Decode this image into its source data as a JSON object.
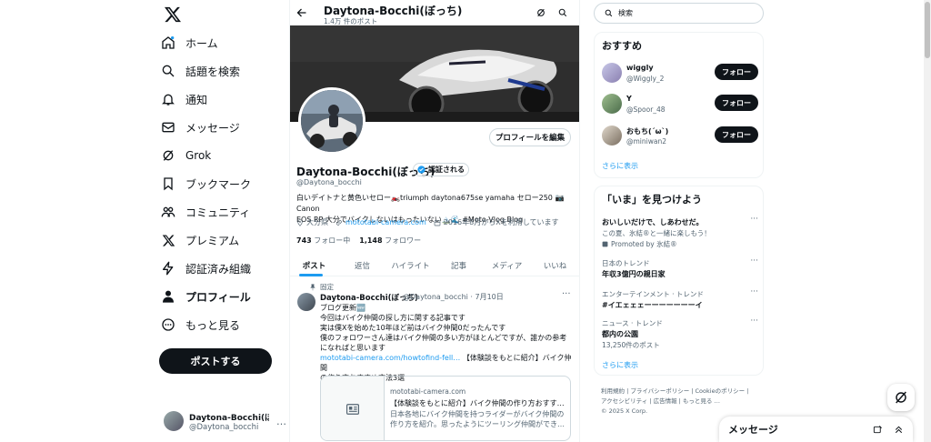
{
  "nav": {
    "items": [
      {
        "label": "ホーム",
        "icon": "home-icon"
      },
      {
        "label": "話題を検索",
        "icon": "search-icon"
      },
      {
        "label": "通知",
        "icon": "bell-icon"
      },
      {
        "label": "メッセージ",
        "icon": "mail-icon"
      },
      {
        "label": "Grok",
        "icon": "grok-icon"
      },
      {
        "label": "ブックマーク",
        "icon": "bookmark-icon"
      },
      {
        "label": "コミュニティ",
        "icon": "community-icon"
      },
      {
        "label": "プレミアム",
        "icon": "x-icon"
      },
      {
        "label": "認証済み組織",
        "icon": "bolt-icon"
      },
      {
        "label": "プロフィール",
        "icon": "person-icon"
      },
      {
        "label": "もっと見る",
        "icon": "more-circle-icon"
      }
    ],
    "post_button": "ポストする",
    "account": {
      "name": "Daytona-Bocchi(ぼ…",
      "handle": "@Daytona_bocchi",
      "more": "…"
    }
  },
  "header": {
    "name": "Daytona-Bocchi(ぼっち)",
    "post_count": "1.4万 件のポスト"
  },
  "profile": {
    "edit_button": "プロフィールを編集",
    "name": "Daytona-Bocchi(ぼっち)",
    "verify_label": "認証される",
    "handle": "@Daytona_bocchi",
    "bio_line1": "白いデイトナと黄色いセロー🏍️triumph daytona675se yamaha セロー250 📷Canon",
    "bio_line2": "EOS RP 大分でバイクしないはもったいない🏔️🌊 #Moto-Vlog Blog",
    "location": "大分県",
    "website": "mototabi-camera.com",
    "joined": "2016年8月からXを利用しています",
    "following_count": "743",
    "following_label": "フォロー中",
    "followers_count": "1,148",
    "followers_label": "フォロワー"
  },
  "tabs": [
    "ポスト",
    "返信",
    "ハイライト",
    "記事",
    "メディア",
    "いいね"
  ],
  "pinned_post": {
    "pinned_label": "固定",
    "author": "Daytona-Bocchi(ぼっち)",
    "handle_date": "@Daytona_bocchi · 7月10日",
    "more": "···",
    "lines": [
      "ブログ更新🆕",
      "今回はバイク仲間の探し方に関する記事です",
      "実は僕Xを始めた10年ほど前はバイク仲間0だったんです",
      "僕のフォロワーさん達はバイク仲間の多い方がほとんどですが、誰かの参考",
      "になればと思います"
    ],
    "link_url": "mototabi-camera.com/howtofind-fell…",
    "link_rest": " 【体験談をもとに紹介】バイク仲間",
    "last_line": "の作り方おすすめ方法3選",
    "card": {
      "domain": "mototabi-camera.com",
      "title": "【体験談をもとに紹介】バイク仲間の作り方おすす…",
      "desc": "日本各地にバイク仲間を持つライダーがバイク仲間の作り方を紹介。思ったようにツーリング仲間ができ…"
    }
  },
  "search": {
    "placeholder": "検索"
  },
  "recommend": {
    "title": "おすすめ",
    "users": [
      {
        "name": "wiggly",
        "handle": "@Wiggly_2",
        "button": "フォロー"
      },
      {
        "name": "Y",
        "handle": "@Spoor_48",
        "button": "フォロー"
      },
      {
        "name": "おもち(´ω`)",
        "handle": "@miniwan2",
        "button": "フォロー"
      }
    ],
    "more": "さらに表示"
  },
  "trends": {
    "title": "「いま」を見つけよう",
    "items": [
      {
        "category": "",
        "title": "おいしいだけで、しあわせだ。",
        "desc": "この夏、氷結®と一緒に楽しもう！",
        "extra": "Promoted by 氷結®"
      },
      {
        "category": "日本のトレンド",
        "title": "年収3億円の親日家",
        "desc": ""
      },
      {
        "category": "エンターテインメント · トレンド",
        "title": "#イエェェェーーーーーーーイ",
        "desc": ""
      },
      {
        "category": "ニュース · トレンド",
        "title": "都内の公園",
        "desc": "13,250件のポスト"
      }
    ],
    "more": "さらに表示"
  },
  "footer": {
    "line1": "利用規約 | プライバシーポリシー | Cookieのポリシー |",
    "line2": "アクセシビリティ | 広告情報 | もっと見る …",
    "line3": "© 2025 X Corp."
  },
  "messages_drawer": {
    "title": "メッセージ"
  }
}
